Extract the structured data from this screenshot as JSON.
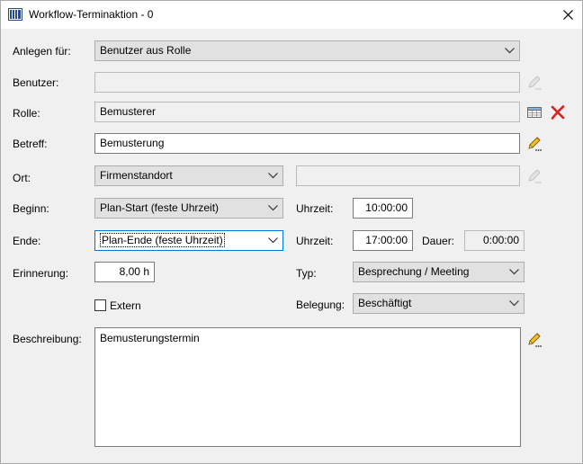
{
  "window": {
    "title": "Workflow-Terminaktion - 0"
  },
  "form": {
    "anlegen_fuer": {
      "label": "Anlegen für:",
      "value": "Benutzer aus Rolle"
    },
    "benutzer": {
      "label": "Benutzer:",
      "value": ""
    },
    "rolle": {
      "label": "Rolle:",
      "value": "Bemusterer"
    },
    "betreff": {
      "label": "Betreff:",
      "value": "Bemusterung"
    },
    "ort": {
      "label": "Ort:",
      "value": "Firmenstandort",
      "extra_value": ""
    },
    "beginn": {
      "label": "Beginn:",
      "value": "Plan-Start (feste Uhrzeit)",
      "time_label": "Uhrzeit:",
      "time_value": "10:00:00"
    },
    "ende": {
      "label": "Ende:",
      "value": "Plan-Ende (feste Uhrzeit)",
      "time_label": "Uhrzeit:",
      "time_value": "17:00:00",
      "dauer_label": "Dauer:",
      "dauer_value": "0:00:00"
    },
    "erinnerung": {
      "label": "Erinnerung:",
      "value": "8,00 h"
    },
    "typ": {
      "label": "Typ:",
      "value": "Besprechung / Meeting"
    },
    "extern": {
      "label": "Extern",
      "checked": false
    },
    "belegung": {
      "label": "Belegung:",
      "value": "Beschäftigt"
    },
    "beschreibung": {
      "label": "Beschreibung:",
      "value": "Bemusterungstermin"
    }
  },
  "icons": {
    "app": "app-columns-icon",
    "close": "close-icon",
    "edit": "pencil-edit-icon",
    "table": "table-select-icon",
    "delete": "red-x-delete-icon"
  },
  "colors": {
    "focus": "#0078d7",
    "delete": "#e02020",
    "pencil": "#d8a000"
  }
}
